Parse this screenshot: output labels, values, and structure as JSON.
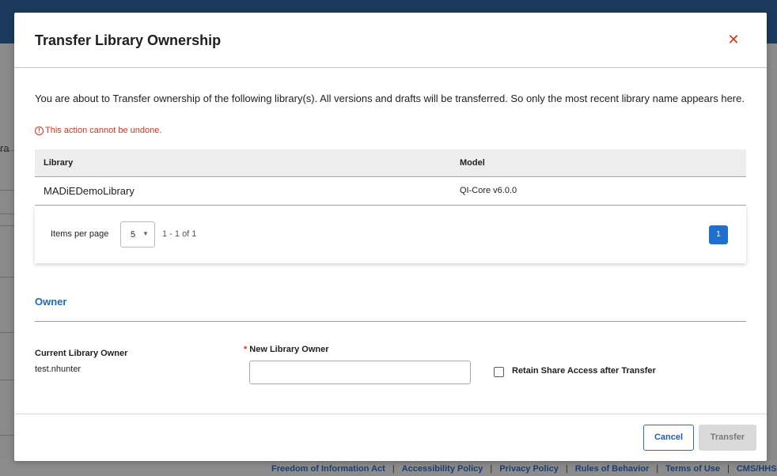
{
  "background": {
    "fragment_text": "ra",
    "footer_links": [
      "Freedom of Information Act",
      "Accessibility Policy",
      "Privacy Policy",
      "Rules of Behavior",
      "Terms of Use",
      "CMS/HHS"
    ],
    "footer_separator": "|"
  },
  "modal": {
    "title": "Transfer Library Ownership",
    "close_icon": "close-icon",
    "close_glyph": "✕",
    "description": "You are about to Transfer ownership of the following library(s). All versions and drafts will be transferred. So only the most recent library name appears here.",
    "warning_icon": "alert-circle-icon",
    "warning_glyph": "!",
    "warning_text": "This action cannot be undone.",
    "table": {
      "headers": [
        "Library",
        "Model"
      ],
      "rows": [
        [
          "MADiEDemoLibrary",
          "QI-Core v6.0.0"
        ]
      ]
    },
    "pagination": {
      "items_per_page_label": "Items per page",
      "items_per_page_value": "5",
      "caret_glyph": "▼",
      "range_text": "1 - 1 of 1",
      "current_page": "1"
    },
    "owner_section": {
      "heading": "Owner",
      "current_owner_label": "Current Library Owner",
      "current_owner_value": "test.nhunter",
      "new_owner_required_marker": "*",
      "new_owner_label": "New Library Owner",
      "new_owner_value": "",
      "retain_share_label": "Retain Share Access after Transfer",
      "retain_share_checked": false
    },
    "buttons": {
      "cancel": "Cancel",
      "transfer": "Transfer"
    }
  },
  "colors": {
    "accent": "#1f6fcf",
    "danger": "#d4351c",
    "header_bg": "#1b3a5c"
  }
}
